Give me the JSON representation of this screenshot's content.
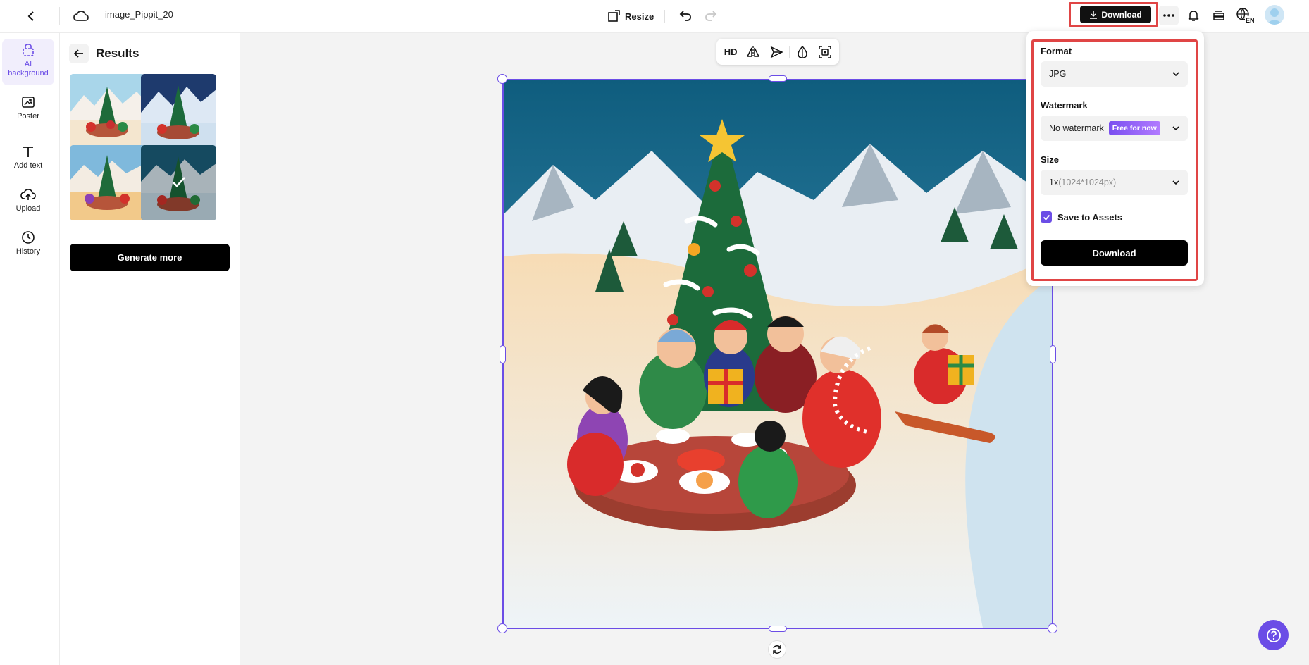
{
  "header": {
    "filename": "image_Pippit_20",
    "resize_label": "Resize",
    "download_label": "Download",
    "lang_label": "EN"
  },
  "leftnav": {
    "items": [
      {
        "label": "AI background",
        "icon": "ai-background-icon",
        "active": true
      },
      {
        "label": "Poster",
        "icon": "poster-icon"
      },
      {
        "label": "Add text",
        "icon": "text-icon"
      },
      {
        "label": "Upload",
        "icon": "upload-icon"
      },
      {
        "label": "History",
        "icon": "history-icon"
      }
    ]
  },
  "panel": {
    "title": "Results",
    "results": [
      {
        "variant": "sunny",
        "selected": false
      },
      {
        "variant": "dusk",
        "selected": false
      },
      {
        "variant": "golden",
        "selected": false
      },
      {
        "variant": "teal",
        "selected": true
      }
    ],
    "generate_more_label": "Generate more"
  },
  "float_toolbar": {
    "hd_label": "HD"
  },
  "download_panel": {
    "format_label": "Format",
    "format_value": "JPG",
    "watermark_label": "Watermark",
    "watermark_value": "No watermark",
    "watermark_badge": "Free for now",
    "size_label": "Size",
    "size_scale": "1x",
    "size_dims": "(1024*1024px)",
    "save_assets_label": "Save to Assets",
    "save_assets_checked": true,
    "download_button_label": "Download"
  },
  "colors": {
    "accent": "#6b4de6",
    "highlight": "#e04545",
    "primary_button": "#000000"
  }
}
